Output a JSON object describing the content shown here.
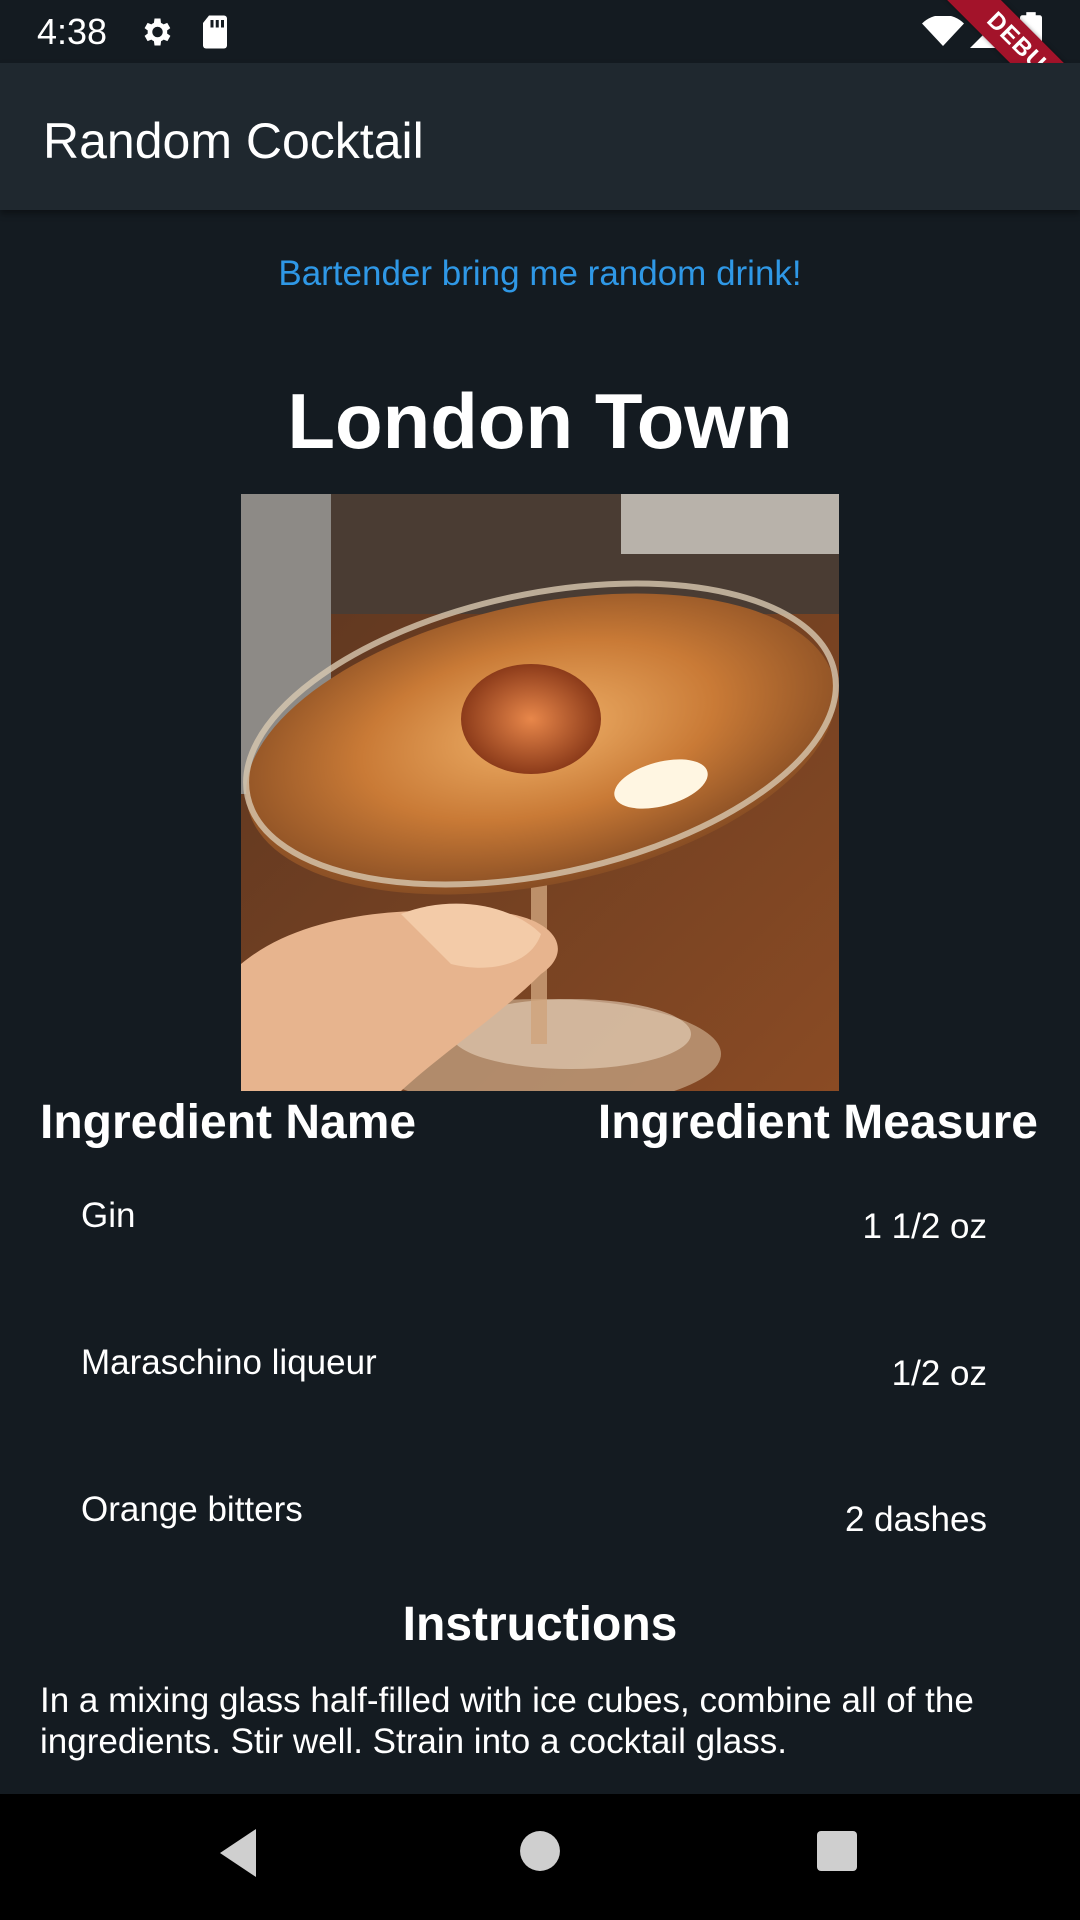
{
  "status_bar": {
    "time": "4:38",
    "icons": [
      "gear-icon",
      "sd-card-icon",
      "wifi-icon",
      "signal-icon",
      "battery-icon"
    ]
  },
  "debug_banner": "DEBUG",
  "app_bar": {
    "title": "Random Cocktail"
  },
  "random_button_label": "Bartender bring me random drink!",
  "drink": {
    "name": "London Town",
    "ingredients_header": {
      "name": "Ingredient Name",
      "measure": "Ingredient Measure"
    },
    "ingredients": [
      {
        "name": "Gin",
        "measure": "1 1/2 oz"
      },
      {
        "name": "Maraschino liqueur",
        "measure": "1/2 oz"
      },
      {
        "name": "Orange bitters",
        "measure": "2 dashes"
      }
    ],
    "instructions_title": "Instructions",
    "instructions": "In a mixing glass half-filled with ice cubes, combine all of the ingredients. Stir well. Strain into a cocktail glass."
  },
  "nav_bar": {
    "buttons": [
      "back-icon",
      "home-icon",
      "recents-icon"
    ]
  },
  "colors": {
    "background": "#141b21",
    "app_bar": "#1f282f",
    "accent": "#2f98e6",
    "debug": "#a3132a"
  }
}
